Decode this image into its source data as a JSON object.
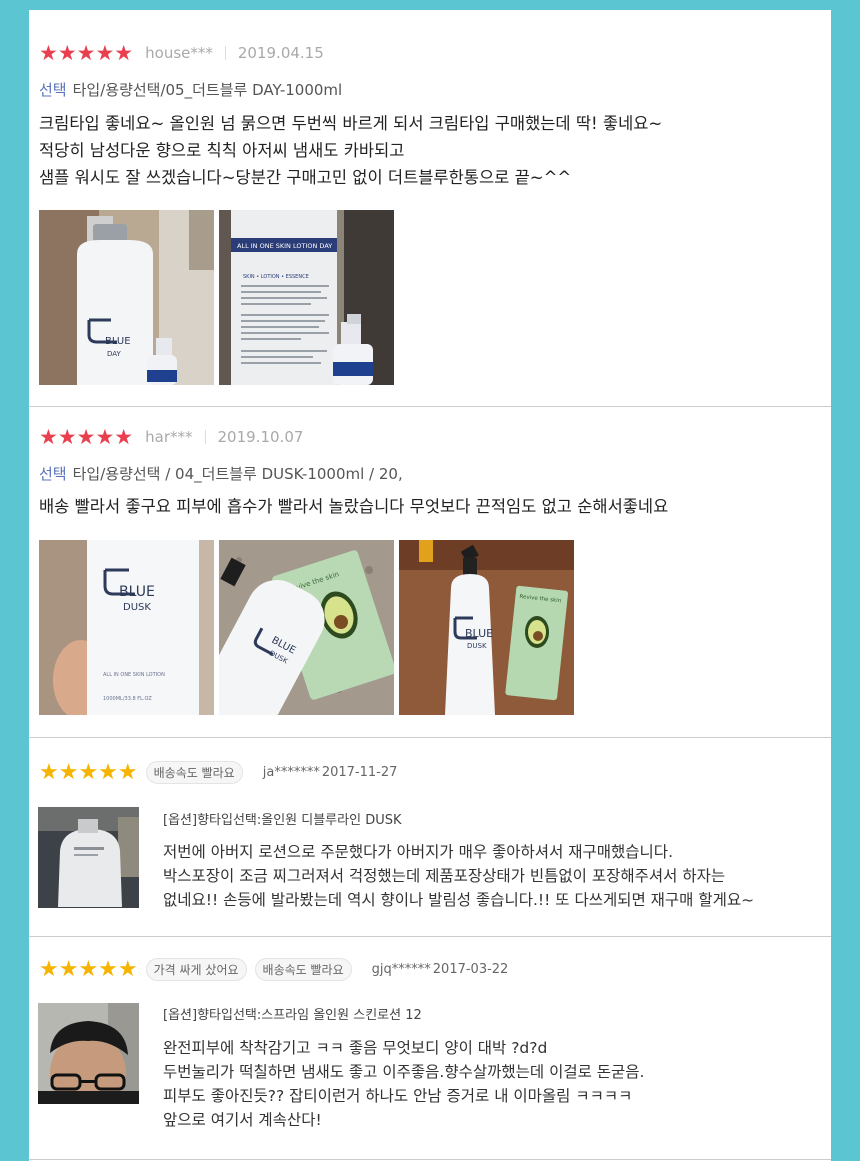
{
  "reviews": [
    {
      "stars": "★★★★★",
      "user": "house***",
      "date": "2019.04.15",
      "option_label": "선택",
      "option": "타입/용량선택/05_더트블루 DAY-1000ml",
      "lines": [
        "크림타입 좋네요~ 올인원 넘 묽으면 두번씩 바르게 되서 크림타입 구매했는데 딱! 좋네요~",
        "적당히 남성다운 향으로 칙칙 아저씨 냄새도 카바되고",
        "샘플 워시도 잘 쓰겠습니다~당분간 구매고민 없이 더트블루한통으로 끝~^^"
      ],
      "photos": [
        {
          "brand": "BLUE",
          "variant": "DAY"
        },
        {
          "label": "ALL IN ONE SKIN LOTION DAY",
          "subline": "SKIN • LOTION • ESSENCE"
        }
      ]
    },
    {
      "stars": "★★★★★",
      "user": "har***",
      "date": "2019.10.07",
      "option_label": "선택",
      "option": "타입/용량선택 / 04_더트블루 DUSK-1000ml / 20,",
      "lines": [
        "배송 빨라서 좋구요 피부에 흡수가 빨라서 놀랐습니다 무엇보다 끈적임도 없고 순해서좋네요"
      ],
      "photos": [
        {
          "brand": "BLUE",
          "variant": "DUSK",
          "small": "ALL IN ONE SKIN LOTION",
          "volume": "1000ML/33.8 FL.OZ"
        },
        {
          "brand": "BLUE",
          "variant": "DUSK",
          "mask": "Revive the skin"
        },
        {
          "brand": "BLUE",
          "variant": "DUSK",
          "mask": "Revive the skin"
        }
      ]
    },
    {
      "stars": "★★★★★",
      "chips": [
        "배송속도 빨라요"
      ],
      "user": "ja*******",
      "date": "2017-11-27",
      "option": "[옵션]향타입선택:올인원 디블루라인 DUSK",
      "lines": [
        "저번에 아버지 로션으로 주문했다가 아버지가 매우 좋아하셔서 재구매했습니다.",
        "박스포장이 조금 찌그러져서 걱정했는데 제품포장상태가 빈틈없이 포장해주셔서 하자는",
        "없네요!! 손등에 발라봤는데 역시 향이나 발림성 좋습니다.!! 또 다쓰게되면 재구매 할게요~"
      ]
    },
    {
      "stars": "★★★★★",
      "chips": [
        "가격 싸게 샀어요",
        "배송속도 빨라요"
      ],
      "user": "gjq******",
      "date": "2017-03-22",
      "option": "[옵션]향타입선택:스프라임 올인원 스킨로션 12",
      "lines": [
        "완전피부에 착착감기고 ㅋㅋ 좋음 무엇보디 양이 대박 ?d?d",
        "두번눌리가 떡칠하면 냄새도 좋고 이주좋음.향수살까했는데 이걸로 돈굳음.",
        "피부도 좋아진듯?? 잡티이런거 하나도 안남 증거로 내 이마올림 ㅋㅋㅋㅋ",
        "앞으로 여기서 계속산다!"
      ]
    }
  ],
  "colors": {
    "page_bg": "#5bc6d2",
    "star_red": "#e8404f",
    "star_gold": "#f5b400",
    "option_accent": "#5a73b8"
  }
}
